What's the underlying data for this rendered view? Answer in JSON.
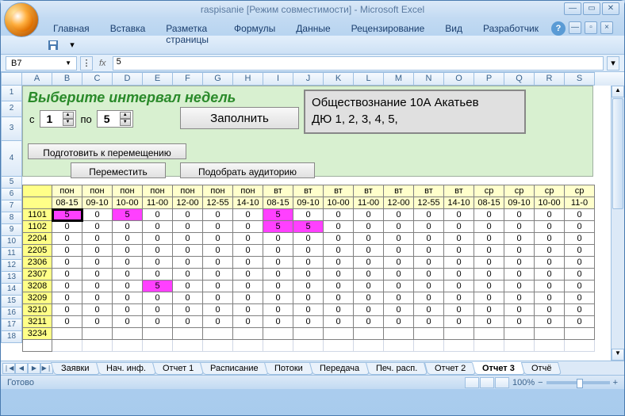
{
  "window": {
    "title": "raspisanie  [Режим совместимости] - Microsoft Excel"
  },
  "ribbon": {
    "tabs": [
      "Главная",
      "Вставка",
      "Разметка страницы",
      "Формулы",
      "Данные",
      "Рецензирование",
      "Вид",
      "Разработчик"
    ]
  },
  "namebox": "B7",
  "formula": "5",
  "columns": [
    "A",
    "B",
    "C",
    "D",
    "E",
    "F",
    "G",
    "H",
    "I",
    "J",
    "K",
    "L",
    "M",
    "N",
    "O",
    "P",
    "Q",
    "R",
    "S"
  ],
  "rows": [
    "1",
    "2",
    "3",
    "4",
    "5",
    "6",
    "7",
    "8",
    "9",
    "10",
    "11",
    "12",
    "13",
    "14",
    "15",
    "16",
    "17",
    "18"
  ],
  "panel": {
    "title": "Выберите интервал недель",
    "from_label": "с",
    "from_val": "1",
    "to_label": "по",
    "to_val": "5",
    "fill_btn": "Заполнить",
    "prep_btn": "Подготовить к перемещению",
    "move_btn": "Переместить",
    "room_btn": "Подобрать аудиторию",
    "info_line1": "Обществознание 10А Акатьев",
    "info_line2": "ДЮ   1, 2, 3, 4, 5,"
  },
  "table": {
    "days": [
      "пон",
      "пон",
      "пон",
      "пон",
      "пон",
      "пон",
      "пон",
      "вт",
      "вт",
      "вт",
      "вт",
      "вт",
      "вт",
      "вт",
      "ср",
      "ср",
      "ср",
      "ср"
    ],
    "times": [
      "08-15",
      "09-10",
      "10-00",
      "11-00",
      "12-00",
      "12-55",
      "14-10",
      "08-15",
      "09-10",
      "10-00",
      "11-00",
      "12-00",
      "12-55",
      "14-10",
      "08-15",
      "09-10",
      "10-00",
      "11-0"
    ],
    "rows": [
      {
        "room": "1101",
        "v": [
          5,
          0,
          5,
          0,
          0,
          0,
          0,
          5,
          0,
          0,
          0,
          0,
          0,
          0,
          0,
          0,
          0,
          0
        ],
        "hot": [
          0,
          2,
          7
        ]
      },
      {
        "room": "1102",
        "v": [
          0,
          0,
          0,
          0,
          0,
          0,
          0,
          5,
          5,
          0,
          0,
          0,
          0,
          0,
          0,
          0,
          0,
          0
        ],
        "hot": [
          7,
          8
        ]
      },
      {
        "room": "2204",
        "v": [
          0,
          0,
          0,
          0,
          0,
          0,
          0,
          0,
          0,
          0,
          0,
          0,
          0,
          0,
          0,
          0,
          0,
          0
        ],
        "hot": []
      },
      {
        "room": "2205",
        "v": [
          0,
          0,
          0,
          0,
          0,
          0,
          0,
          0,
          0,
          0,
          0,
          0,
          0,
          0,
          0,
          0,
          0,
          0
        ],
        "hot": []
      },
      {
        "room": "2306",
        "v": [
          0,
          0,
          0,
          0,
          0,
          0,
          0,
          0,
          0,
          0,
          0,
          0,
          0,
          0,
          0,
          0,
          0,
          0
        ],
        "hot": []
      },
      {
        "room": "2307",
        "v": [
          0,
          0,
          0,
          0,
          0,
          0,
          0,
          0,
          0,
          0,
          0,
          0,
          0,
          0,
          0,
          0,
          0,
          0
        ],
        "hot": []
      },
      {
        "room": "3208",
        "v": [
          0,
          0,
          0,
          5,
          0,
          0,
          0,
          0,
          0,
          0,
          0,
          0,
          0,
          0,
          0,
          0,
          0,
          0
        ],
        "hot": [
          3
        ]
      },
      {
        "room": "3209",
        "v": [
          0,
          0,
          0,
          0,
          0,
          0,
          0,
          0,
          0,
          0,
          0,
          0,
          0,
          0,
          0,
          0,
          0,
          0
        ],
        "hot": []
      },
      {
        "room": "3210",
        "v": [
          0,
          0,
          0,
          0,
          0,
          0,
          0,
          0,
          0,
          0,
          0,
          0,
          0,
          0,
          0,
          0,
          0,
          0
        ],
        "hot": []
      },
      {
        "room": "3211",
        "v": [
          0,
          0,
          0,
          0,
          0,
          0,
          0,
          0,
          0,
          0,
          0,
          0,
          0,
          0,
          0,
          0,
          0,
          0
        ],
        "hot": []
      },
      {
        "room": "3234",
        "v": [
          "",
          "",
          "",
          "",
          "",
          "",
          "",
          "",
          "",
          "",
          "",
          "",
          "",
          "",
          "",
          "",
          "",
          ""
        ],
        "hot": []
      }
    ]
  },
  "sheet_tabs": [
    "Заявки",
    "Нач. инф.",
    "Отчет 1",
    "Расписание",
    "Потоки",
    "Передача",
    "Печ. расп.",
    "Отчет 2",
    "Отчет 3",
    "Отчё"
  ],
  "active_tab": "Отчет 3",
  "status": "Готово",
  "zoom": "100%"
}
